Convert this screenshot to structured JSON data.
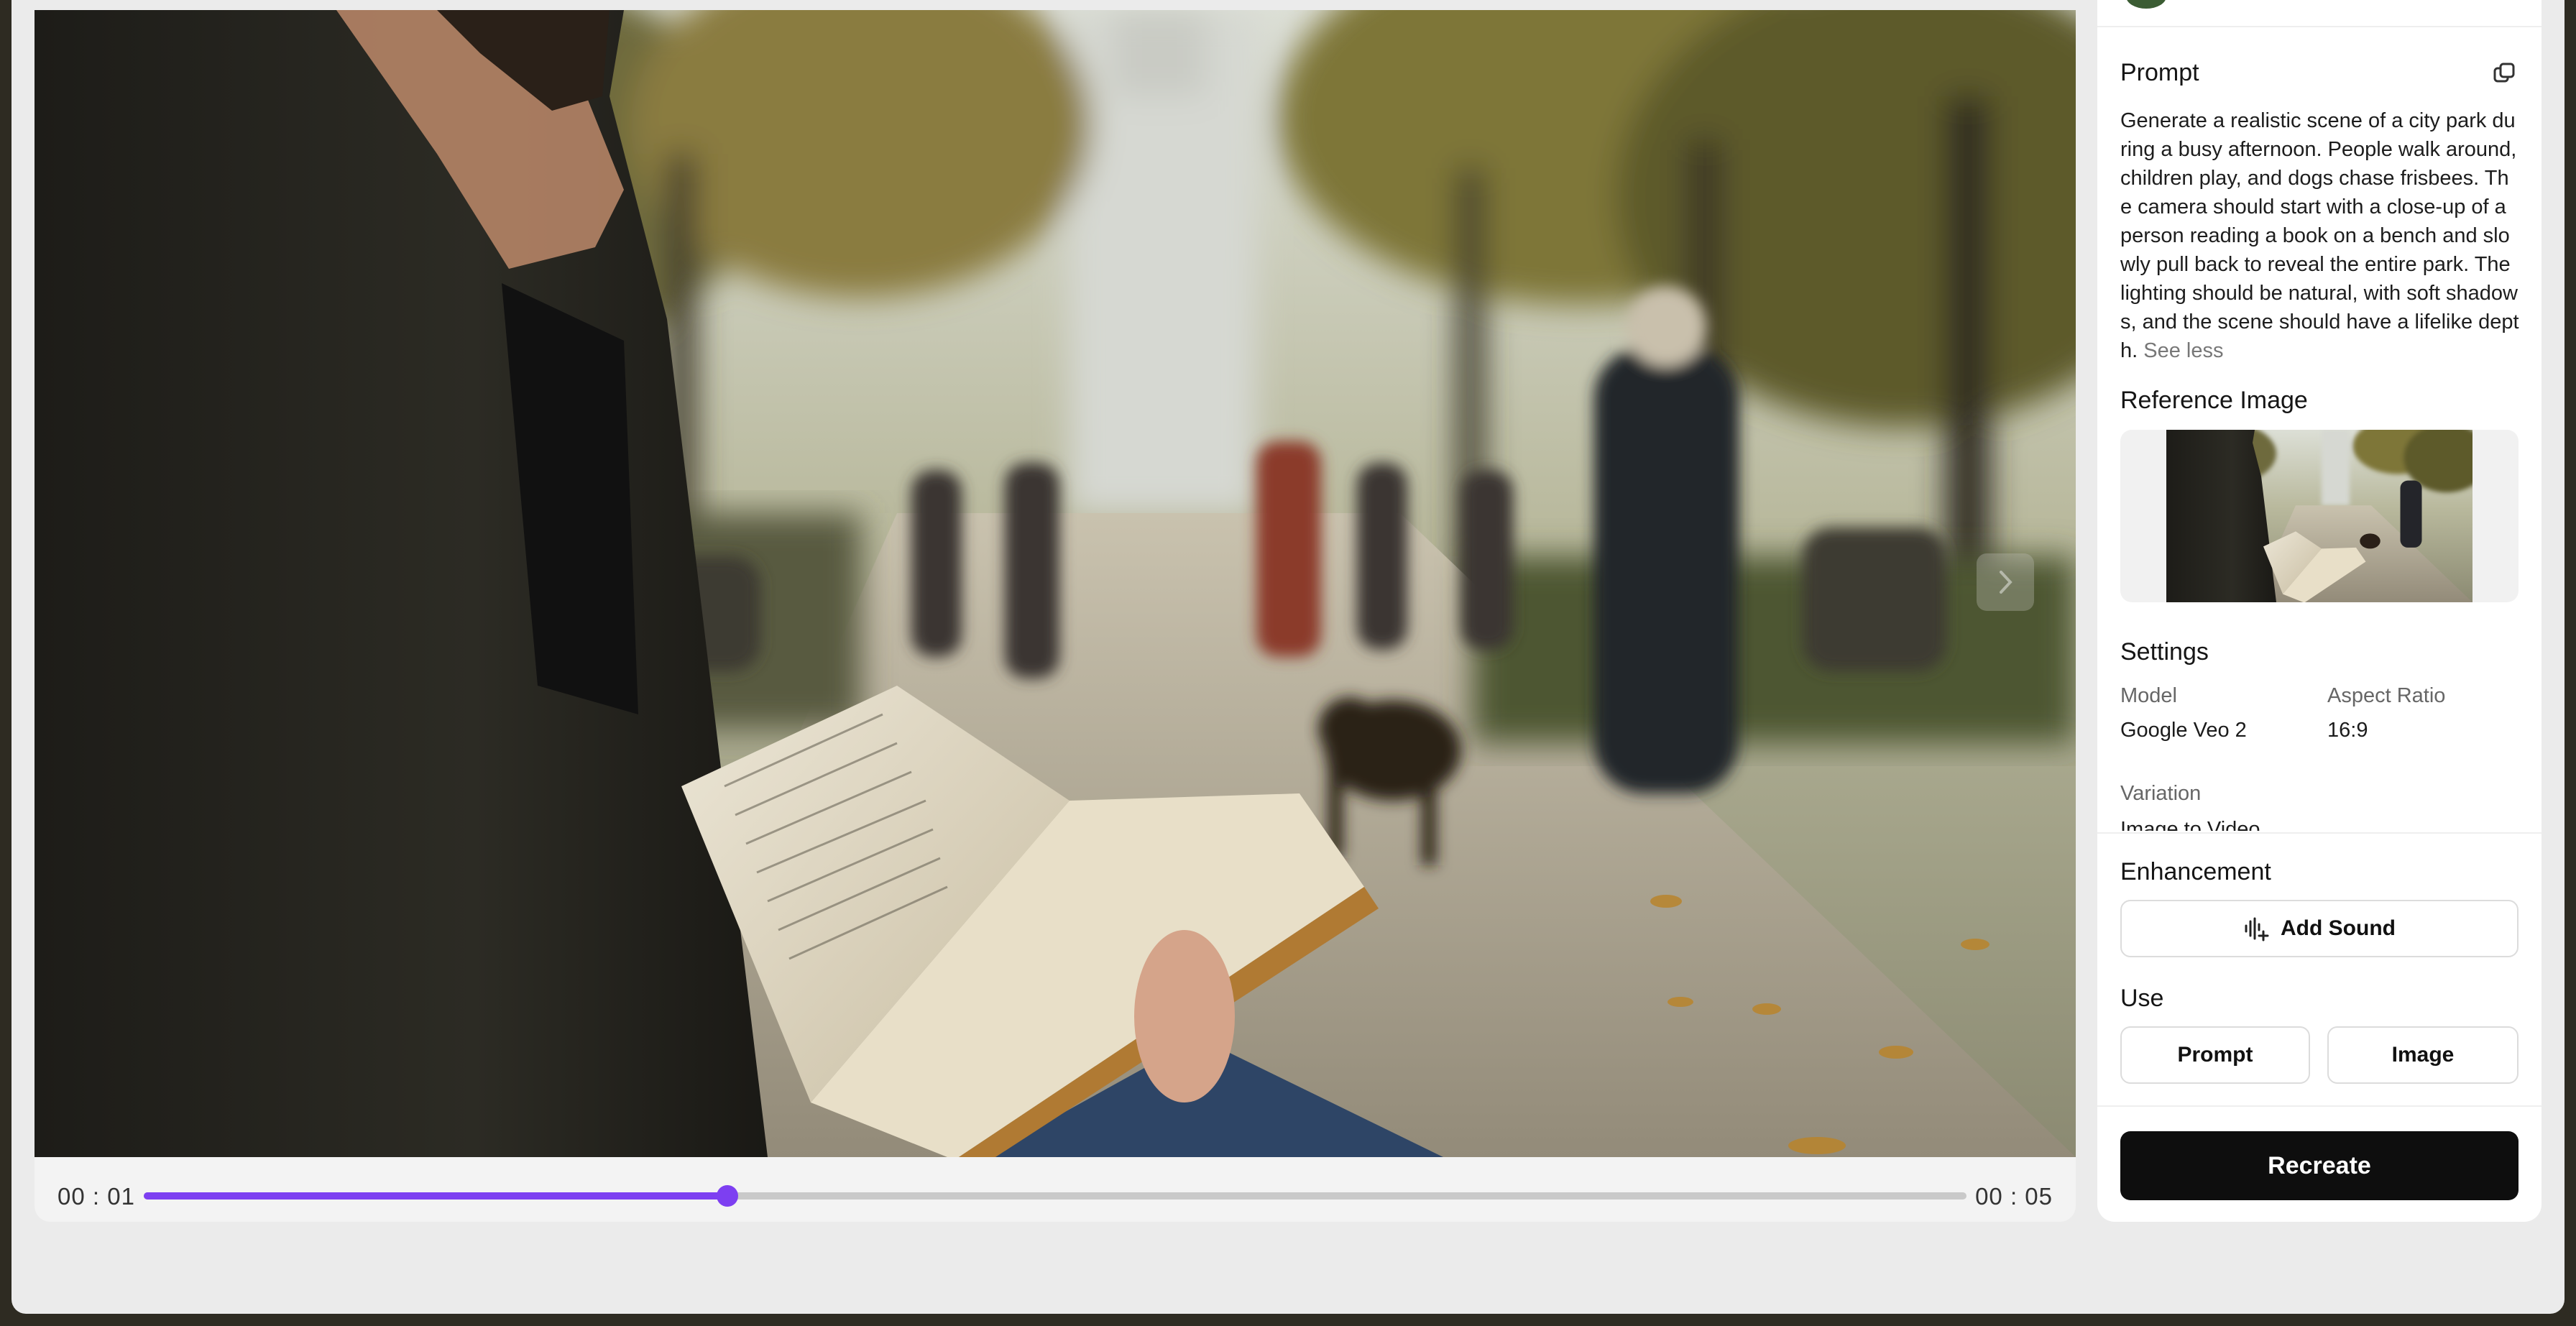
{
  "player": {
    "current_time": "00 : 01",
    "duration": "00 : 05",
    "progress": 0.32,
    "accent_color": "#7d3ff1"
  },
  "panel": {
    "prompt_title": "Prompt",
    "prompt_text": "Generate a realistic scene of a city park during a busy afternoon. People walk around, children play, and dogs chase frisbees. The camera should start with a close-up of a person reading a book on a bench and slowly pull back to reveal the entire park. The lighting should be natural, with soft shadows, and the scene should have a lifelike depth.",
    "see_less": "See less",
    "reference_title": "Reference Image",
    "settings_title": "Settings",
    "model_label": "Model",
    "model_value": "Google Veo 2",
    "aspect_label": "Aspect Ratio",
    "aspect_value": "16:9",
    "variation_label": "Variation",
    "variation_value": "Image to Video",
    "enhancement_title": "Enhancement",
    "add_sound_label": "Add Sound",
    "use_title": "Use",
    "use_prompt_label": "Prompt",
    "use_image_label": "Image",
    "recreate_label": "Recreate"
  },
  "icons": {
    "copy": "copy-icon",
    "add_sound": "audio-plus-icon",
    "next": "chevron-right-icon"
  }
}
